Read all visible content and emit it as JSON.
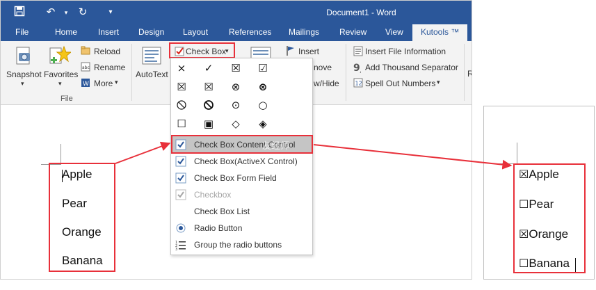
{
  "window": {
    "title": "Document1 - Word"
  },
  "tabs": [
    "File",
    "Home",
    "Insert",
    "Design",
    "Layout",
    "References",
    "Mailings",
    "Review",
    "View",
    "Kutools ™"
  ],
  "ribbon": {
    "file_group": {
      "snapshot": "Snapshot",
      "favorites": "Favorites",
      "reload": "Reload",
      "rename": "Rename",
      "more": "More",
      "group_label": "File"
    },
    "autotext": "AutoText",
    "check_box": "Check Box",
    "insert": "Insert",
    "remove_partial": "nove",
    "show_hide_partial": "w/Hide",
    "insert_file_information": "Insert File Information",
    "add_thousand_separator": "Add Thousand Separator",
    "spell_out_numbers": "Spell Out Numbers",
    "cut_edge": "R"
  },
  "menu": {
    "symbols": [
      "×",
      "✓",
      "☒",
      "☑",
      "☒",
      "☒",
      "⊗",
      "⊗",
      "⃠",
      "⃠",
      "⊙",
      "○",
      "☐",
      "▣",
      "◇",
      "◈"
    ],
    "items": [
      {
        "label": "Check Box Content Control",
        "icon": "checkbox-icon"
      },
      {
        "label": "Check Box(ActiveX Control)",
        "icon": "checkbox-icon"
      },
      {
        "label": "Check Box Form Field",
        "icon": "checkbox-icon"
      },
      {
        "label": "Checkbox",
        "icon": "checkbox-icon"
      },
      {
        "label": "Check Box List",
        "icon": ""
      },
      {
        "label": "Radio Button",
        "icon": "radio-icon"
      },
      {
        "label": "Group the radio buttons",
        "icon": "list-icon"
      }
    ],
    "watermark": "友经师"
  },
  "document": {
    "lines": [
      "Apple",
      "Pear",
      "Orange",
      "Banana"
    ]
  },
  "result": {
    "lines": [
      {
        "box": "☒",
        "text": "Apple"
      },
      {
        "box": "☐",
        "text": "Pear"
      },
      {
        "box": "☒",
        "text": "Orange"
      },
      {
        "box": "☐",
        "text": "Banana"
      }
    ]
  },
  "colors": {
    "word_blue": "#2b579a",
    "annotation_red": "#e8303a",
    "menu_highlight": "#c5c5c5"
  }
}
